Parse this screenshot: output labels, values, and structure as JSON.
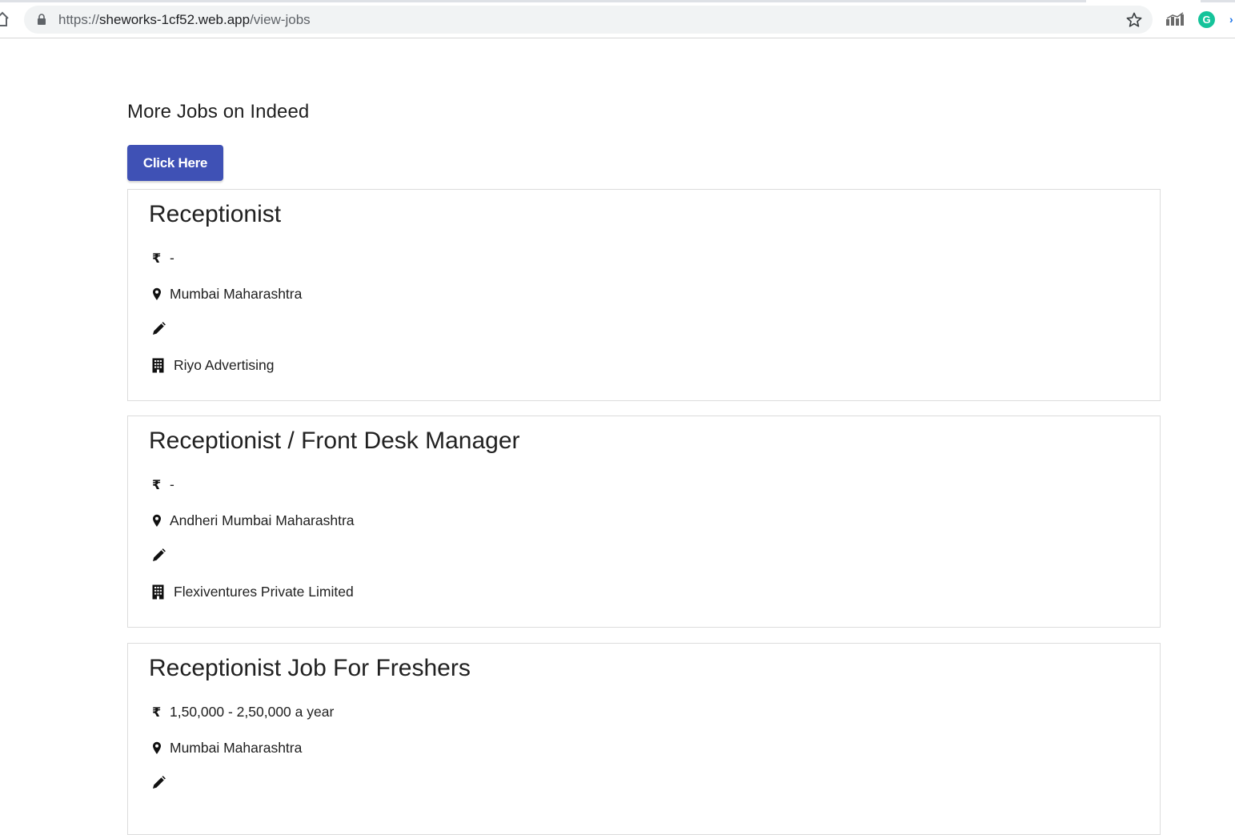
{
  "browser": {
    "url_prefix": "https://",
    "url_host": "sheworks-1cf52.web.app",
    "url_path": "/view-jobs",
    "grammarly_letter": "G",
    "overflow_glyph": "›"
  },
  "page": {
    "section_title": "More Jobs on Indeed",
    "cta_label": "Click Here",
    "accent_color": "#3f51b5"
  },
  "jobs": [
    {
      "title": "Receptionist",
      "salary": "-",
      "location": "Mumbai Maharashtra",
      "company": "Riyo Advertising"
    },
    {
      "title": "Receptionist / Front Desk Manager",
      "salary": "-",
      "location": "Andheri Mumbai Maharashtra",
      "company": "Flexiventures Private Limited"
    },
    {
      "title": "Receptionist Job For Freshers",
      "salary": "1,50,000 - 2,50,000 a year",
      "location": "Mumbai Maharashtra",
      "company": ""
    }
  ],
  "icons": {
    "salary": "rupee-icon",
    "location": "map-marker-icon",
    "description": "pencil-icon",
    "company": "building-icon",
    "rupee_glyph": "₹"
  }
}
